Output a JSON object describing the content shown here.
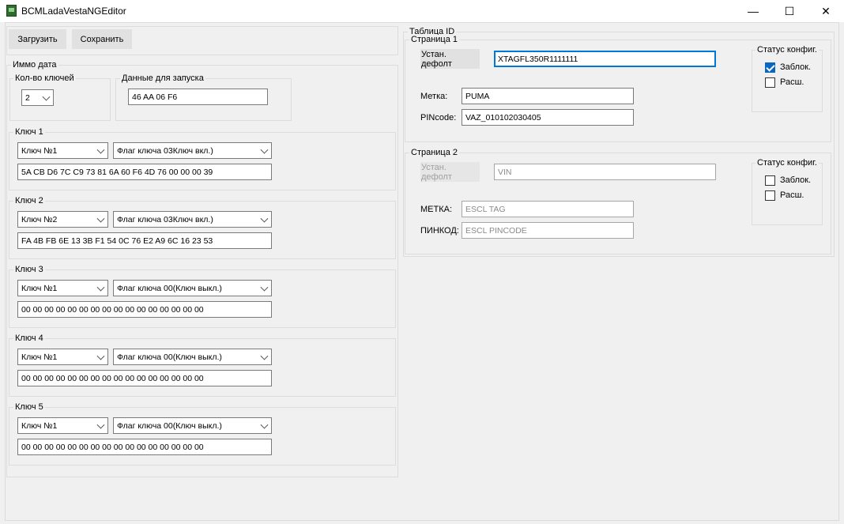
{
  "window": {
    "title": "BCMLadaVestaNGEditor",
    "icon": "app-icon",
    "minimize_glyph": "—",
    "maximize_glyph": "☐",
    "close_glyph": "✕"
  },
  "toolbar": {
    "load_label": "Загрузить",
    "save_label": "Сохранить"
  },
  "immo": {
    "group_label": "Иммо дата",
    "key_count": {
      "label": "Кол-во ключей",
      "value": "2"
    },
    "start_data": {
      "label": "Данные для запуска",
      "value": "46 AA 06 F6"
    },
    "keys": [
      {
        "label": "Ключ 1",
        "key_select": "Ключ №1",
        "flag_select": "Флаг ключа 03Ключ вкл.)",
        "data": "5A CB D6 7C C9 73 81 6A 60 F6 4D 76 00 00 00 39"
      },
      {
        "label": "Ключ 2",
        "key_select": "Ключ №2",
        "flag_select": "Флаг ключа 03Ключ вкл.)",
        "data": "FA 4B FB 6E 13 3B F1 54 0C 76 E2 A9 6C 16 23 53"
      },
      {
        "label": "Ключ 3",
        "key_select": "Ключ №1",
        "flag_select": "Флаг ключа 00(Ключ выкл.)",
        "data": "00 00 00 00 00 00 00 00 00 00 00 00 00 00 00 00"
      },
      {
        "label": "Ключ 4",
        "key_select": "Ключ №1",
        "flag_select": "Флаг ключа 00(Ключ выкл.)",
        "data": "00 00 00 00 00 00 00 00 00 00 00 00 00 00 00 00"
      },
      {
        "label": "Ключ 5",
        "key_select": "Ключ №1",
        "flag_select": "Флаг ключа 00(Ключ выкл.)",
        "data": "00 00 00 00 00 00 00 00 00 00 00 00 00 00 00 00"
      }
    ]
  },
  "id_table": {
    "group_label": "Таблица ID",
    "page1": {
      "label": "Страница 1",
      "default_button": "Устан. дефолт",
      "vin_value": "XTAGFL350R1111111",
      "tag_label": "Метка:",
      "tag_value": "PUMA",
      "pin_label": "PINcode:",
      "pin_value": "VAZ_010102030405",
      "status": {
        "label": "Статус конфиг.",
        "locked_label": "Заблок.",
        "locked": true,
        "ext_label": "Расш.",
        "ext": false
      }
    },
    "page2": {
      "label": "Страница 2",
      "default_button": "Устан. дефолт",
      "vin_value": "VIN",
      "tag_label": "МЕТКА:",
      "tag_value": "ESCL TAG",
      "pin_label": "ПИНКОД:",
      "pin_value": "ESCL PINCODE",
      "status": {
        "label": "Статус конфиг.",
        "locked_label": "Заблок.",
        "locked": false,
        "ext_label": "Расш.",
        "ext": false
      }
    }
  },
  "colors": {
    "accent": "#0078d7",
    "checked": "#0a66c2",
    "background": "#f0f0f0"
  }
}
